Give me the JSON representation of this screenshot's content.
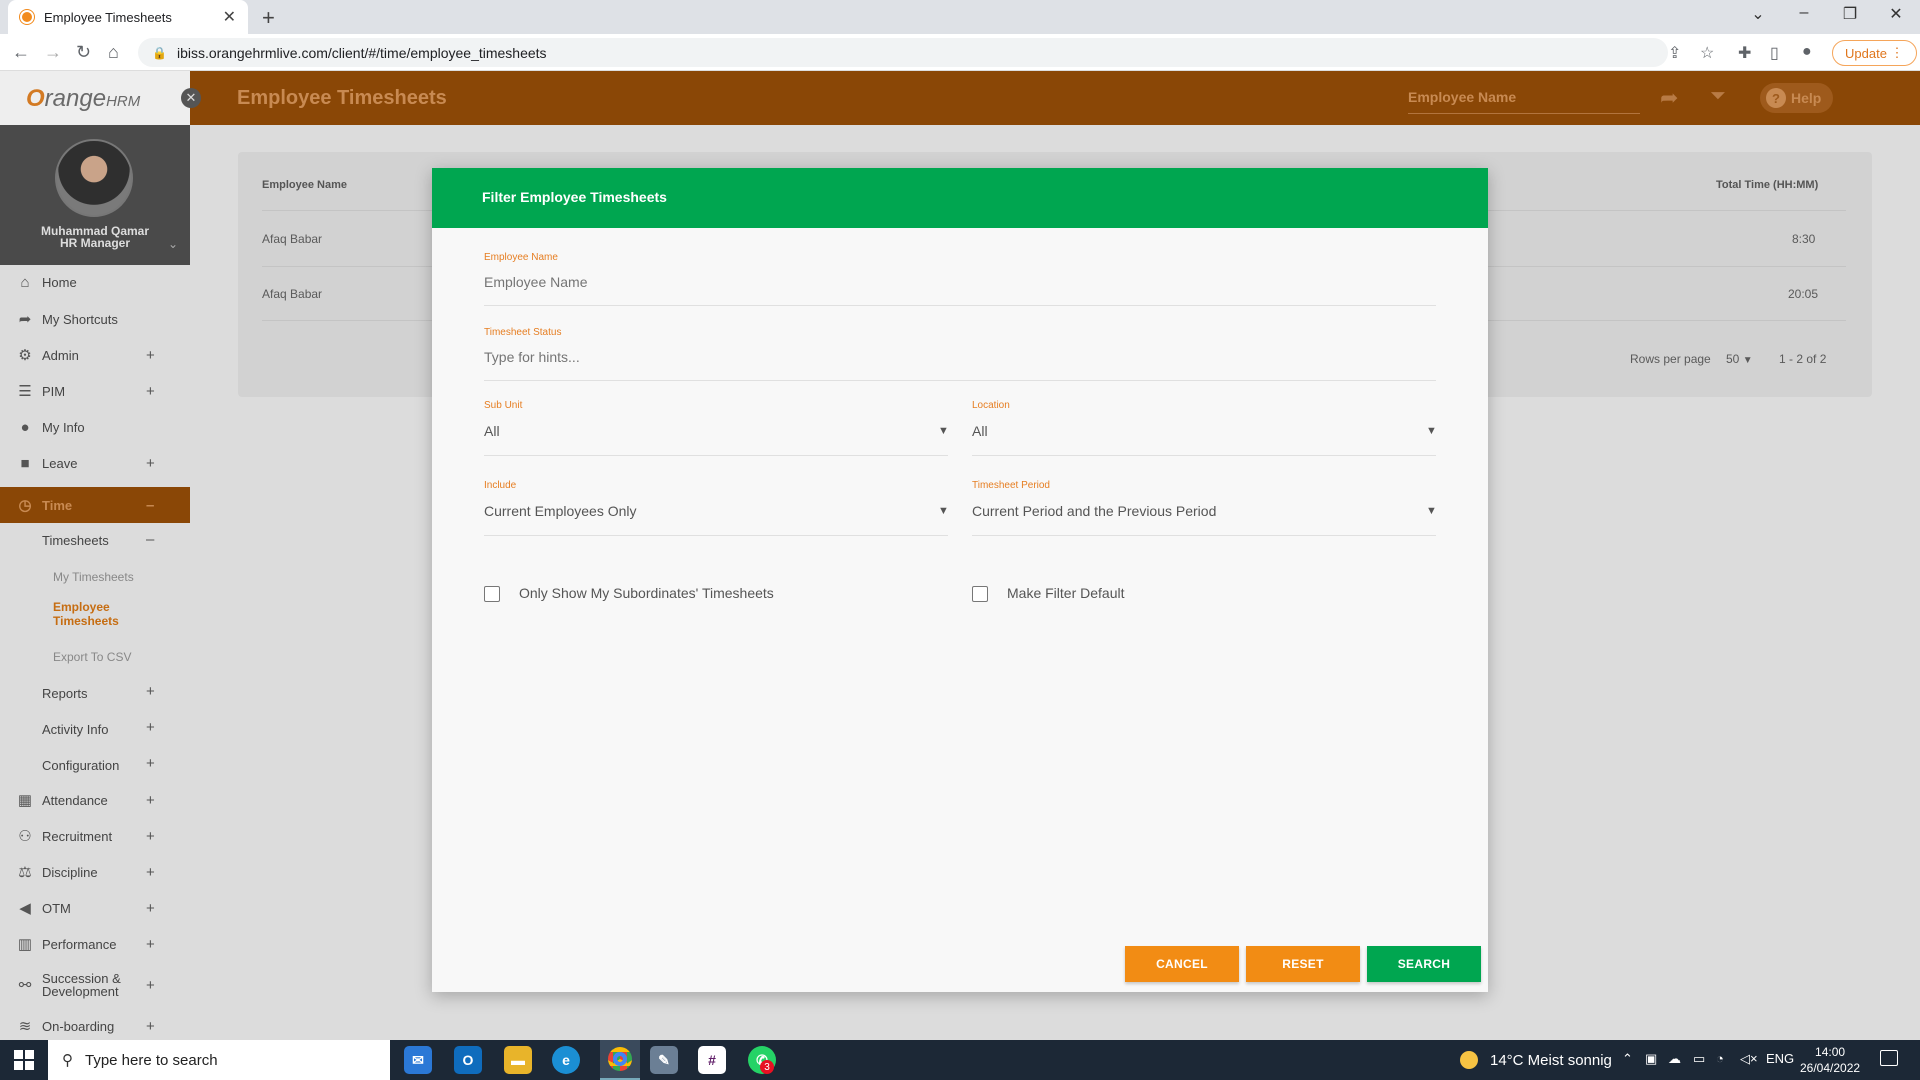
{
  "browser": {
    "tab_title": "Employee Timesheets",
    "tab_close": "✕",
    "new_tab": "+",
    "url": "ibiss.orangehrmlive.com/client/#/time/employee_timesheets",
    "update_label": "Update"
  },
  "header": {
    "page_title": "Employee Timesheets",
    "search_placeholder": "Employee Name",
    "help_label": "Help",
    "help_icon": "?"
  },
  "sidebar": {
    "logo_text": "range",
    "logo_text2": "HRM",
    "logo_o": "O",
    "close_icon": "✕",
    "user_name": "Muhammad Qamar",
    "user_role": "HR Manager",
    "items": [
      {
        "label": "Home",
        "icon": "home-icon"
      },
      {
        "label": "My Shortcuts",
        "icon": "share-icon"
      },
      {
        "label": "Admin",
        "icon": "admin-icon"
      },
      {
        "label": "PIM",
        "icon": "pim-icon"
      },
      {
        "label": "My Info",
        "icon": "user-icon"
      },
      {
        "label": "Leave",
        "icon": "briefcase-icon"
      },
      {
        "label": "Time",
        "icon": "clock-icon"
      }
    ],
    "time_sub": {
      "timesheets": "Timesheets",
      "my_timesheets": "My Timesheets",
      "employee_timesheets": "Employee Timesheets",
      "export_csv": "Export To CSV",
      "reports": "Reports",
      "activity_info": "Activity Info",
      "configuration": "Configuration"
    },
    "items_lower": [
      {
        "label": "Attendance",
        "icon": "attendance-icon"
      },
      {
        "label": "Recruitment",
        "icon": "recruitment-icon"
      },
      {
        "label": "Discipline",
        "icon": "discipline-icon"
      },
      {
        "label": "OTM",
        "icon": "megaphone-icon"
      },
      {
        "label": "Performance",
        "icon": "chart-icon"
      },
      {
        "label": "Succession & Development",
        "icon": "succession-icon"
      },
      {
        "label": "On-boarding",
        "icon": "onboarding-icon"
      }
    ]
  },
  "table": {
    "col_employee": "Employee Name",
    "col_total": "Total Time (HH:MM)",
    "rows": [
      {
        "name": "Afaq Babar",
        "total": "8:30"
      },
      {
        "name": "Afaq Babar",
        "total": "20:05"
      }
    ],
    "rows_per_page_label": "Rows per page",
    "rows_per_page": "50",
    "pagination": "1 - 2 of 2"
  },
  "modal": {
    "title": "Filter Employee Timesheets",
    "employee_name_label": "Employee Name",
    "employee_name_placeholder": "Employee Name",
    "status_label": "Timesheet Status",
    "status_placeholder": "Type for hints...",
    "subunit_label": "Sub Unit",
    "subunit_value": "All",
    "location_label": "Location",
    "location_value": "All",
    "include_label": "Include",
    "include_value": "Current Employees Only",
    "period_label": "Timesheet Period",
    "period_value": "Current Period and the Previous Period",
    "subordinates_label": "Only Show My Subordinates' Timesheets",
    "default_label": "Make Filter Default",
    "cancel_label": "CANCEL",
    "reset_label": "RESET",
    "search_label": "SEARCH"
  },
  "taskbar": {
    "search_placeholder": "Type here to search",
    "badge_count": "3",
    "weather": "14°C  Meist sonnig",
    "language": "ENG",
    "time": "14:00",
    "date": "26/04/2022"
  }
}
